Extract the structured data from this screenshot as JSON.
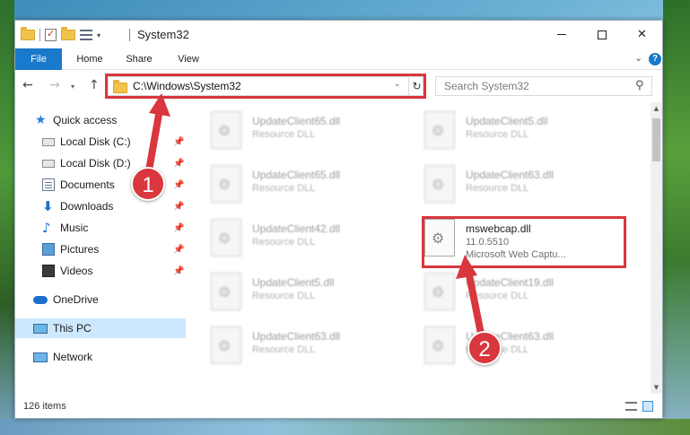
{
  "window": {
    "title": "System32",
    "controls": {
      "minimize": "—",
      "maximize": "□",
      "close": "✕"
    }
  },
  "ribbon": {
    "tabs": [
      "File",
      "Home",
      "Share",
      "View"
    ],
    "help": "?"
  },
  "address": {
    "path": "C:\\Windows\\System32",
    "search_placeholder": "Search System32"
  },
  "sidebar": {
    "items": [
      {
        "label": "Quick access",
        "icon": "star-icon"
      },
      {
        "label": "Local Disk (C:)",
        "icon": "drive-icon",
        "pinned": true
      },
      {
        "label": "Local Disk (D:)",
        "icon": "drive-icon",
        "pinned": true
      },
      {
        "label": "Documents",
        "icon": "document-icon",
        "pinned": true
      },
      {
        "label": "Downloads",
        "icon": "download-icon",
        "pinned": true
      },
      {
        "label": "Music",
        "icon": "music-icon",
        "pinned": true
      },
      {
        "label": "Pictures",
        "icon": "pictures-icon",
        "pinned": true
      },
      {
        "label": "Videos",
        "icon": "video-icon",
        "pinned": true
      },
      {
        "label": "OneDrive",
        "icon": "cloud-icon"
      },
      {
        "label": "This PC",
        "icon": "computer-icon",
        "selected": true
      },
      {
        "label": "Network",
        "icon": "network-icon"
      }
    ]
  },
  "files": [
    {
      "name": "UpdateClient65.dll",
      "type": "Resource DLL"
    },
    {
      "name": "UpdateClient5.dll",
      "type": "Resource DLL"
    },
    {
      "name": "UpdateClient65.dll",
      "type": "Resource DLL"
    },
    {
      "name": "UpdateClient63.dll",
      "type": "Resource DLL"
    },
    {
      "name": "UpdateClient42.dll",
      "type": "Resource DLL"
    },
    {
      "name": "mswebcap.dll",
      "version": "11.0.5510",
      "description": "Microsoft Web Captu..."
    },
    {
      "name": "UpdateClient5.dll",
      "type": "Resource DLL"
    },
    {
      "name": "UpdateClient19.dll",
      "type": "Resource DLL"
    },
    {
      "name": "UpdateClient63.dll",
      "type": "Resource DLL"
    },
    {
      "name": "UpdateClient63.dll",
      "type": "Resource DLL"
    }
  ],
  "status": {
    "item_count": "126 items"
  },
  "callouts": {
    "step1": "1",
    "step2": "2"
  },
  "colors": {
    "accent": "#1979ca",
    "highlight": "#d9363e",
    "selected": "#cce8ff"
  }
}
